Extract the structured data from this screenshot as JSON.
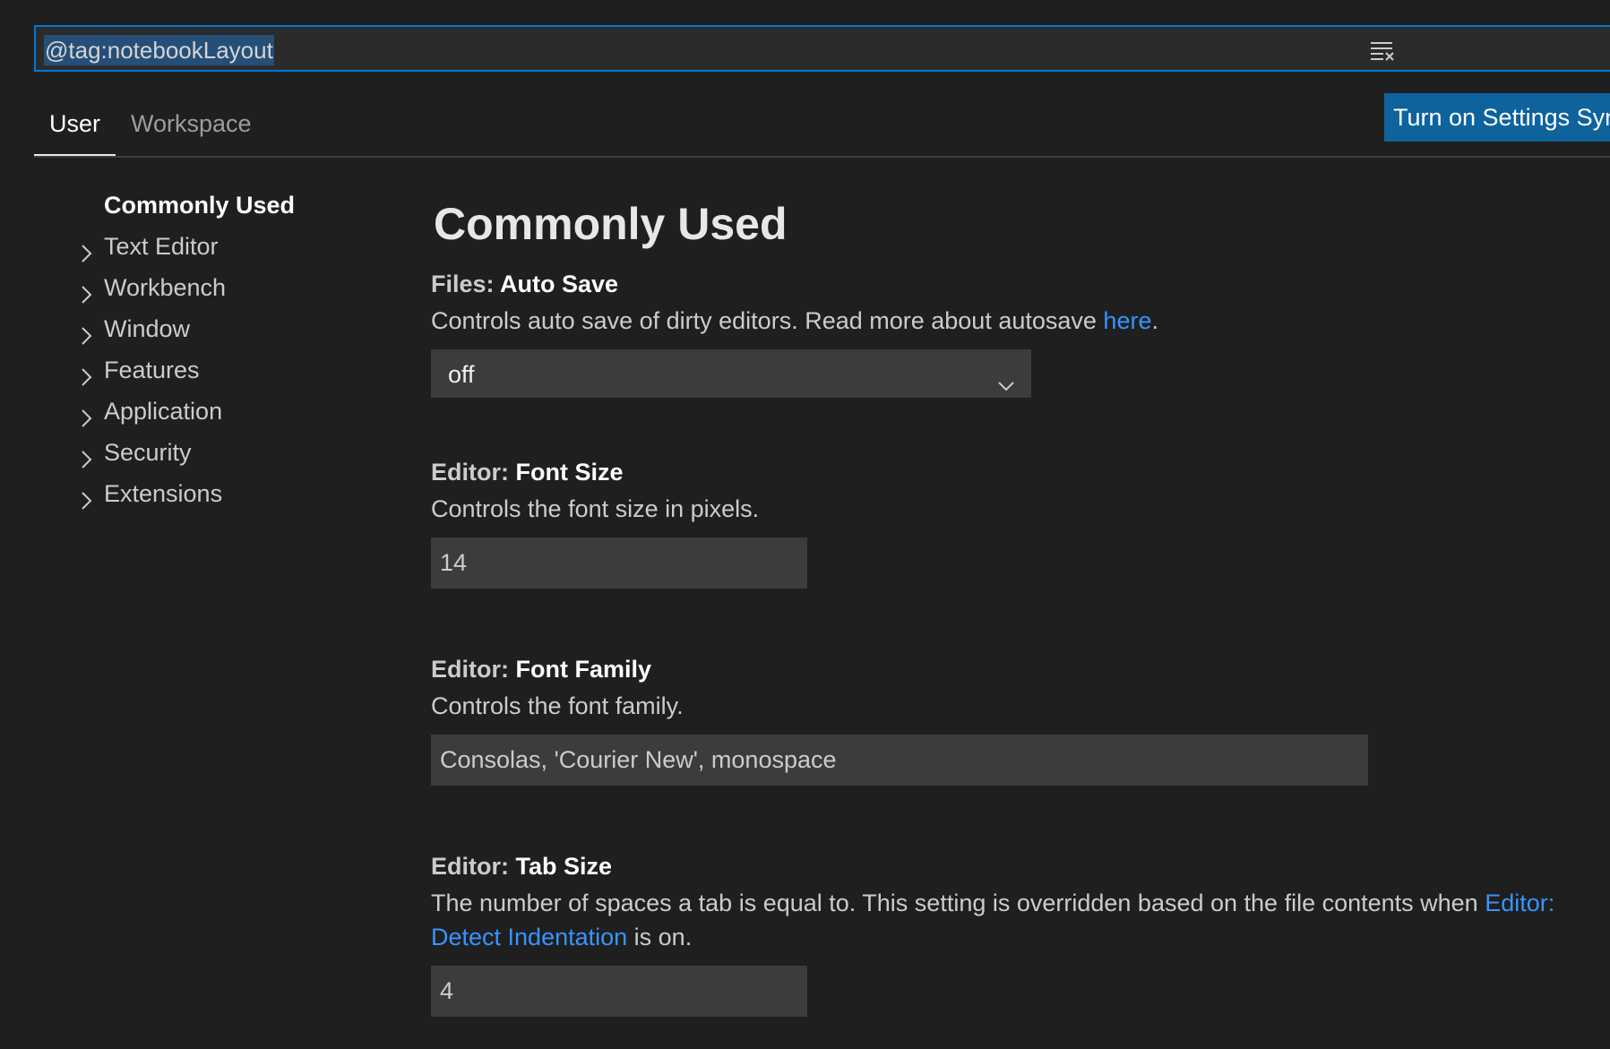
{
  "search": {
    "value": "@tag:notebookLayout",
    "clear_icon": "clear-filter-icon"
  },
  "tabs": [
    {
      "label": "User",
      "active": true
    },
    {
      "label": "Workspace",
      "active": false
    }
  ],
  "sync_button": {
    "label": "Turn on Settings Sync"
  },
  "toc": {
    "items": [
      {
        "label": "Commonly Used",
        "selected": true,
        "expandable": false
      },
      {
        "label": "Text Editor",
        "selected": false,
        "expandable": true
      },
      {
        "label": "Workbench",
        "selected": false,
        "expandable": true
      },
      {
        "label": "Window",
        "selected": false,
        "expandable": true
      },
      {
        "label": "Features",
        "selected": false,
        "expandable": true
      },
      {
        "label": "Application",
        "selected": false,
        "expandable": true
      },
      {
        "label": "Security",
        "selected": false,
        "expandable": true
      },
      {
        "label": "Extensions",
        "selected": false,
        "expandable": true
      }
    ]
  },
  "main": {
    "section_title": "Commonly Used",
    "settings": {
      "auto_save": {
        "category": "Files: ",
        "name": "Auto Save",
        "desc_prefix": "Controls auto save of dirty editors. Read more about autosave ",
        "desc_link": "here",
        "desc_suffix": ".",
        "value": "off"
      },
      "font_size": {
        "category": "Editor: ",
        "name": "Font Size",
        "desc": "Controls the font size in pixels.",
        "value": "14"
      },
      "font_family": {
        "category": "Editor: ",
        "name": "Font Family",
        "desc": "Controls the font family.",
        "value": "Consolas, 'Courier New', monospace"
      },
      "tab_size": {
        "category": "Editor: ",
        "name": "Tab Size",
        "desc_prefix": "The number of spaces a tab is equal to. This setting is overridden based on the file contents when ",
        "desc_link": "Editor: Detect Indentation",
        "desc_suffix": " is on.",
        "value": "4"
      }
    }
  },
  "colors": {
    "background": "#1f1f1f",
    "accent": "#0078d4",
    "button": "#0e639c",
    "link": "#3794ff",
    "input_bg": "#3c3c3c"
  }
}
